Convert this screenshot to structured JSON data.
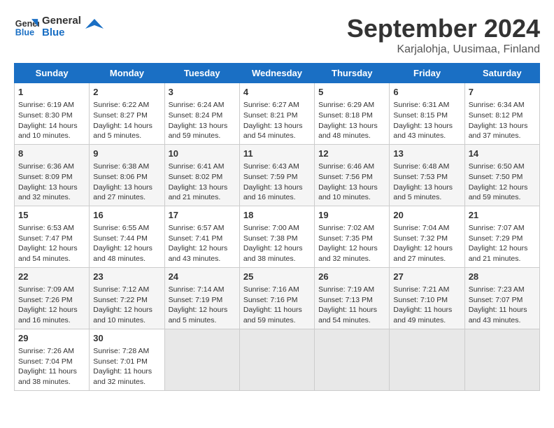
{
  "header": {
    "logo_line1": "General",
    "logo_line2": "Blue",
    "month_title": "September 2024",
    "location": "Karjalohja, Uusimaa, Finland"
  },
  "weekdays": [
    "Sunday",
    "Monday",
    "Tuesday",
    "Wednesday",
    "Thursday",
    "Friday",
    "Saturday"
  ],
  "weeks": [
    [
      {
        "day": "1",
        "info": "Sunrise: 6:19 AM\nSunset: 8:30 PM\nDaylight: 14 hours and 10 minutes."
      },
      {
        "day": "2",
        "info": "Sunrise: 6:22 AM\nSunset: 8:27 PM\nDaylight: 14 hours and 5 minutes."
      },
      {
        "day": "3",
        "info": "Sunrise: 6:24 AM\nSunset: 8:24 PM\nDaylight: 13 hours and 59 minutes."
      },
      {
        "day": "4",
        "info": "Sunrise: 6:27 AM\nSunset: 8:21 PM\nDaylight: 13 hours and 54 minutes."
      },
      {
        "day": "5",
        "info": "Sunrise: 6:29 AM\nSunset: 8:18 PM\nDaylight: 13 hours and 48 minutes."
      },
      {
        "day": "6",
        "info": "Sunrise: 6:31 AM\nSunset: 8:15 PM\nDaylight: 13 hours and 43 minutes."
      },
      {
        "day": "7",
        "info": "Sunrise: 6:34 AM\nSunset: 8:12 PM\nDaylight: 13 hours and 37 minutes."
      }
    ],
    [
      {
        "day": "8",
        "info": "Sunrise: 6:36 AM\nSunset: 8:09 PM\nDaylight: 13 hours and 32 minutes."
      },
      {
        "day": "9",
        "info": "Sunrise: 6:38 AM\nSunset: 8:06 PM\nDaylight: 13 hours and 27 minutes."
      },
      {
        "day": "10",
        "info": "Sunrise: 6:41 AM\nSunset: 8:02 PM\nDaylight: 13 hours and 21 minutes."
      },
      {
        "day": "11",
        "info": "Sunrise: 6:43 AM\nSunset: 7:59 PM\nDaylight: 13 hours and 16 minutes."
      },
      {
        "day": "12",
        "info": "Sunrise: 6:46 AM\nSunset: 7:56 PM\nDaylight: 13 hours and 10 minutes."
      },
      {
        "day": "13",
        "info": "Sunrise: 6:48 AM\nSunset: 7:53 PM\nDaylight: 13 hours and 5 minutes."
      },
      {
        "day": "14",
        "info": "Sunrise: 6:50 AM\nSunset: 7:50 PM\nDaylight: 12 hours and 59 minutes."
      }
    ],
    [
      {
        "day": "15",
        "info": "Sunrise: 6:53 AM\nSunset: 7:47 PM\nDaylight: 12 hours and 54 minutes."
      },
      {
        "day": "16",
        "info": "Sunrise: 6:55 AM\nSunset: 7:44 PM\nDaylight: 12 hours and 48 minutes."
      },
      {
        "day": "17",
        "info": "Sunrise: 6:57 AM\nSunset: 7:41 PM\nDaylight: 12 hours and 43 minutes."
      },
      {
        "day": "18",
        "info": "Sunrise: 7:00 AM\nSunset: 7:38 PM\nDaylight: 12 hours and 38 minutes."
      },
      {
        "day": "19",
        "info": "Sunrise: 7:02 AM\nSunset: 7:35 PM\nDaylight: 12 hours and 32 minutes."
      },
      {
        "day": "20",
        "info": "Sunrise: 7:04 AM\nSunset: 7:32 PM\nDaylight: 12 hours and 27 minutes."
      },
      {
        "day": "21",
        "info": "Sunrise: 7:07 AM\nSunset: 7:29 PM\nDaylight: 12 hours and 21 minutes."
      }
    ],
    [
      {
        "day": "22",
        "info": "Sunrise: 7:09 AM\nSunset: 7:26 PM\nDaylight: 12 hours and 16 minutes."
      },
      {
        "day": "23",
        "info": "Sunrise: 7:12 AM\nSunset: 7:22 PM\nDaylight: 12 hours and 10 minutes."
      },
      {
        "day": "24",
        "info": "Sunrise: 7:14 AM\nSunset: 7:19 PM\nDaylight: 12 hours and 5 minutes."
      },
      {
        "day": "25",
        "info": "Sunrise: 7:16 AM\nSunset: 7:16 PM\nDaylight: 11 hours and 59 minutes."
      },
      {
        "day": "26",
        "info": "Sunrise: 7:19 AM\nSunset: 7:13 PM\nDaylight: 11 hours and 54 minutes."
      },
      {
        "day": "27",
        "info": "Sunrise: 7:21 AM\nSunset: 7:10 PM\nDaylight: 11 hours and 49 minutes."
      },
      {
        "day": "28",
        "info": "Sunrise: 7:23 AM\nSunset: 7:07 PM\nDaylight: 11 hours and 43 minutes."
      }
    ],
    [
      {
        "day": "29",
        "info": "Sunrise: 7:26 AM\nSunset: 7:04 PM\nDaylight: 11 hours and 38 minutes."
      },
      {
        "day": "30",
        "info": "Sunrise: 7:28 AM\nSunset: 7:01 PM\nDaylight: 11 hours and 32 minutes."
      },
      {
        "day": "",
        "info": ""
      },
      {
        "day": "",
        "info": ""
      },
      {
        "day": "",
        "info": ""
      },
      {
        "day": "",
        "info": ""
      },
      {
        "day": "",
        "info": ""
      }
    ]
  ]
}
